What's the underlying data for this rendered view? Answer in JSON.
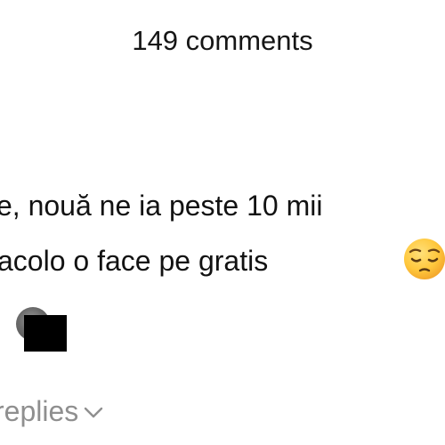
{
  "header": {
    "comments_count": "149 comments"
  },
  "comment": {
    "line1": "e, nouă ne ia peste 10 mii",
    "line2": "acolo o face pe gratis",
    "emoji": "pensive-face-icon"
  },
  "replies": {
    "label": "replies",
    "icon": "chevron-down-icon"
  },
  "colors": {
    "text": "#121212",
    "muted": "#8f8f8f",
    "emoji_yellow": "#FFC83D",
    "redaction": "#000000"
  }
}
